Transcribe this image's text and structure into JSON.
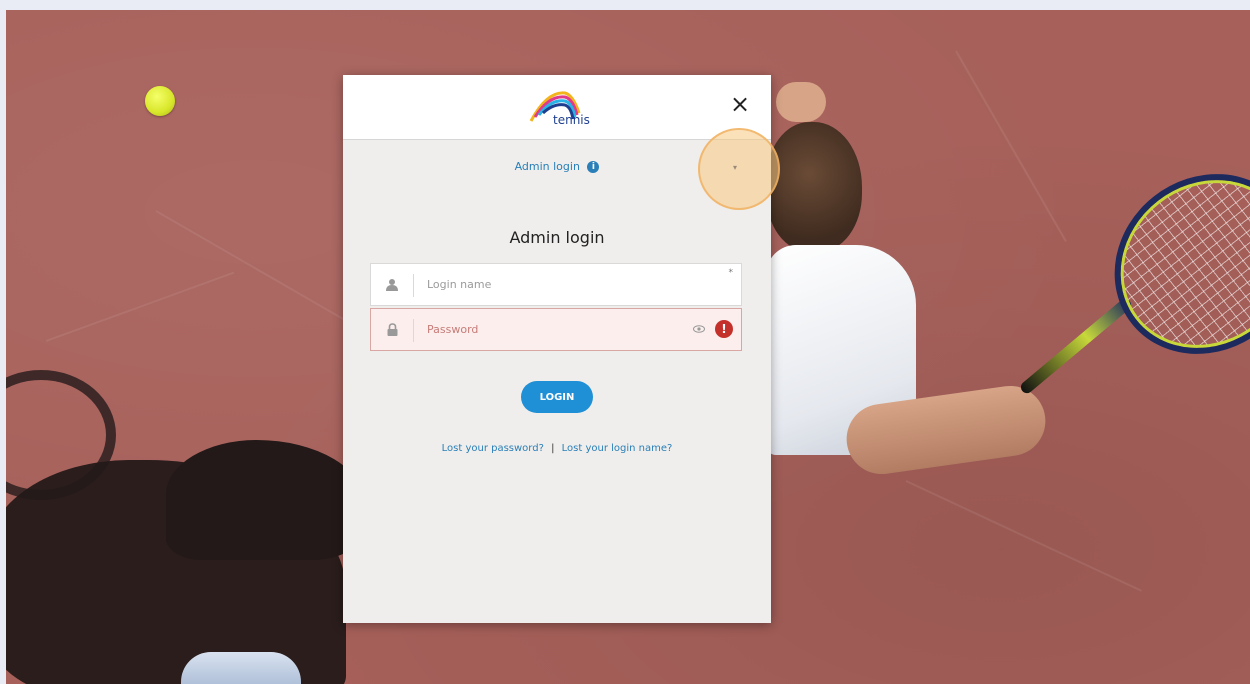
{
  "modal": {
    "logo_text": "tennis",
    "close_symbol": "×",
    "admin_toggle_label": "Admin login",
    "info_symbol": "i",
    "chevron_symbol": "▾",
    "form_title": "Admin login",
    "login_name_placeholder": "Login name",
    "password_placeholder": "Password",
    "required_marker": "*",
    "error_symbol": "!",
    "login_button": "LOGIN",
    "lost_password": "Lost your password?",
    "link_separator": "|",
    "lost_login_name": "Lost your login name?"
  },
  "icons": {
    "close": "close-icon",
    "info": "info-icon",
    "user": "user-icon",
    "lock": "lock-icon",
    "eye": "eye-icon",
    "error": "error-icon"
  },
  "colors": {
    "accent": "#1f8fd6",
    "link": "#2a7fb8",
    "error": "#c4312b",
    "background_court": "#a7605a"
  }
}
